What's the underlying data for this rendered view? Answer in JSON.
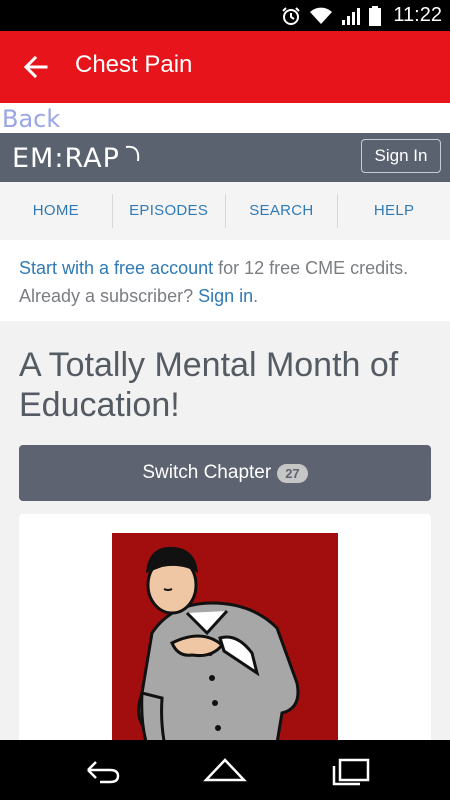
{
  "status_bar": {
    "time": "11:22",
    "icons": [
      "alarm-icon",
      "wifi-icon",
      "signal-icon",
      "battery-icon"
    ]
  },
  "app_bar": {
    "title": "Chest Pain",
    "back_icon": "arrow-left-icon",
    "color": "#e8141b"
  },
  "web": {
    "back_link": "Back",
    "header": {
      "logo": "EM:RAP",
      "signin_label": "Sign In"
    },
    "nav": {
      "items": [
        "HOME",
        "EPISODES",
        "SEARCH",
        "HELP"
      ]
    },
    "signup": {
      "link1": "Start with a free account",
      "text1": " for 12 free CME credits. Already a subscriber? ",
      "link2": "Sign in",
      "text2": "."
    },
    "title": "A Totally Mental Month of Education!",
    "switch_chapter": {
      "label": "Switch Chapter",
      "count": "27"
    },
    "illustration": "man-clutching-chest-illustration"
  },
  "system_nav": {
    "icons": [
      "back-nav-icon",
      "home-nav-icon",
      "recents-nav-icon"
    ]
  },
  "colors": {
    "accent_red": "#e8141b",
    "header_gray": "#5a6270",
    "link_blue": "#2f7ab6"
  }
}
